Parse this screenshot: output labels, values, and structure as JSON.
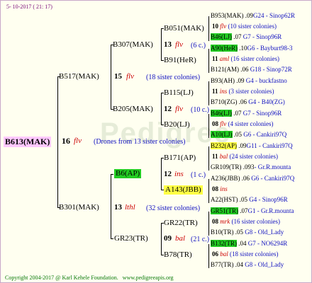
{
  "header": {
    "date": "5- 10-2017 ( 21: 17)"
  },
  "root": {
    "id": "B613(MAK)",
    "num": "16",
    "cls": "flv",
    "note": "(Drones from 13 sister colonies)"
  },
  "gen1": [
    {
      "id": "B517(MAK)",
      "num": "15",
      "cls": "flv",
      "note": "(18 sister colonies)"
    },
    {
      "id": "B301(MAK)",
      "num": "13",
      "cls": "lthl",
      "note": "(32 sister colonies)"
    }
  ],
  "gen2": [
    {
      "id": "B307(MAK)",
      "num": "13",
      "cls": "flv",
      "note": "(6 c.)"
    },
    {
      "id": "B205(MAK)",
      "num": "12",
      "cls": "flv",
      "note": "(10 c.)"
    },
    {
      "id": "B6(AP)",
      "num": "12",
      "cls": "ins",
      "note": "(1 c.)"
    },
    {
      "id": "GR23(TR)",
      "num": "09",
      "cls": "bal",
      "note": "(21 c.)"
    }
  ],
  "gen3": [
    {
      "id": "B051(MAK)"
    },
    {
      "id": "B91(HeR)"
    },
    {
      "id": "B115(LJ)"
    },
    {
      "id": "B20(LJ)"
    },
    {
      "id": "B171(AP)"
    },
    {
      "id": "A143(JBB)"
    },
    {
      "id": "GR22(TR)"
    },
    {
      "id": "B78(TR)"
    }
  ],
  "gen4": [
    {
      "queen": "B953(MAK)",
      "pct": ".09",
      "breeder": "G24 - Sinop62R",
      "num": "10",
      "cls": "flv",
      "note": "(10 sister colonies)",
      "drone": "B46(LJ)",
      "dpct": ".07",
      "dbreeder": "G7 - Sinop96R"
    },
    {
      "queen": "A90(HeR)",
      "pct": ".10",
      "breeder": "G6 - Bayburt98-3",
      "num": "11",
      "cls": "aml",
      "note": "(16 sister colonies)",
      "drone": "B121(AM)",
      "dpct": ".06",
      "dbreeder": "G18 - Sinop72R"
    },
    {
      "queen": "B93(AH)",
      "pct": ".09",
      "breeder": "G4 - buckfastno",
      "num": "11",
      "cls": "ins",
      "note": "(3 sister colonies)",
      "drone": "B710(ZG)",
      "dpct": ".06",
      "dbreeder": "G4 - B40(ZG)"
    },
    {
      "queen": "B46(LJ)",
      "pct": ".07",
      "breeder": "G7 - Sinop96R",
      "num": "08",
      "cls": "flv",
      "note": "(4 sister colonies)",
      "drone": "A10(LJ)",
      "dpct": ".05",
      "dbreeder": "G6 - Cankiri97Q"
    },
    {
      "queen": "B232(AP)",
      "pct": ".09",
      "breeder": "G11 - Cankiri97Q",
      "num": "11",
      "cls": "bal",
      "note": "(24 sister colonies)",
      "drone": "GR109(TR)",
      "dpct": ".093",
      "dbreeder": "- Gr.R.mounta"
    },
    {
      "queen": "A236(JBB)",
      "pct": ".06",
      "breeder": "G6 - Cankiri97Q",
      "num": "08",
      "cls": "ins",
      "note": "",
      "drone": "A22(HST)",
      "dpct": ".05",
      "dbreeder": "G4 - Sinop96R"
    },
    {
      "queen": "GR51(TR)",
      "pct": ".07",
      "breeder": "G1 - Gr.R.mounta",
      "num": "08",
      "cls": "mrk",
      "note": "(16 sister colonies)",
      "drone": "B10(TR)",
      "dpct": ".05",
      "dbreeder": "G8 - Old_Lady"
    },
    {
      "queen": "B132(TR)",
      "pct": ".04",
      "breeder": "G7 - NO6294R",
      "num": "06",
      "cls": "bal",
      "note": "(18 sister colonies)",
      "drone": "B77(TR)",
      "dpct": ".04",
      "dbreeder": "G8 - Old_Lady"
    }
  ],
  "footer": {
    "copyright": "Copyright 2004-2017 @ Karl Kehele Foundation.",
    "site": "www.pedigreeapis.org"
  }
}
